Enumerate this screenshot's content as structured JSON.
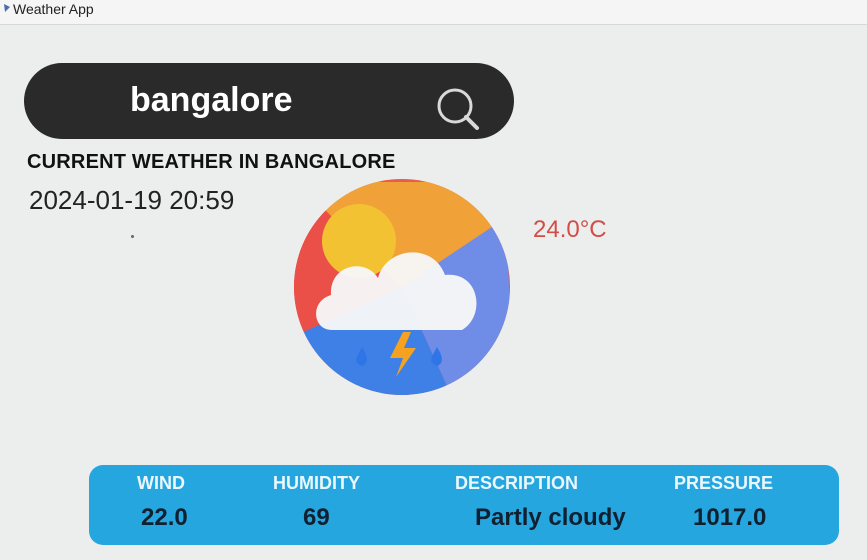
{
  "window": {
    "title": "Weather App"
  },
  "search": {
    "value": "bangalore"
  },
  "weather": {
    "heading": "CURRENT WEATHER IN BANGALORE",
    "datetime": "2024-01-19 20:59",
    "temperature": "24.0°C",
    "icon": "cloud-sun-rain-storm-icon"
  },
  "details": {
    "wind_label": "WIND",
    "wind_value": "22.0",
    "humidity_label": "HUMIDITY",
    "humidity_value": "69",
    "description_label": "DESCRIPTION",
    "description_value": "Partly cloudy",
    "pressure_label": "PRESSURE",
    "pressure_value": "1017.0"
  },
  "colors": {
    "search_bg": "#2a2a2a",
    "panel_bg": "#26a6df",
    "temperature": "#d34c48"
  }
}
